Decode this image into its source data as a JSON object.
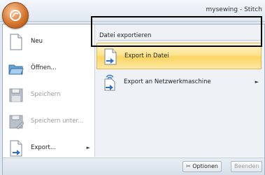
{
  "app": {
    "title": "mysewing - Stitch"
  },
  "left_menu": {
    "items": [
      {
        "label": "Neu",
        "icon": "new-document-icon",
        "enabled": true,
        "submenu": false
      },
      {
        "label": "Öffnen...",
        "icon": "open-folder-icon",
        "enabled": true,
        "submenu": false
      },
      {
        "label": "Speichern",
        "icon": "save-disk-icon",
        "enabled": false,
        "submenu": false
      },
      {
        "label": "Speichern unter...",
        "icon": "save-as-disk-icon",
        "enabled": false,
        "submenu": false
      },
      {
        "label": "Export...",
        "icon": "export-document-icon",
        "enabled": true,
        "submenu": true
      }
    ]
  },
  "submenu": {
    "header": "Datei exportieren",
    "items": [
      {
        "label": "Export in Datei",
        "icon": "export-file-icon",
        "highlighted": true,
        "submenu": false
      },
      {
        "label": "Export an Netzwerkmaschine",
        "icon": "export-network-icon",
        "highlighted": false,
        "submenu": true
      }
    ]
  },
  "footer": {
    "options_label": "Optionen",
    "exit_label": "Beenden"
  },
  "colors": {
    "highlight": "#fbd462",
    "highlight_border": "#e3b94e",
    "orb": "#d6762e",
    "disabled_text": "#9a9a9a"
  }
}
